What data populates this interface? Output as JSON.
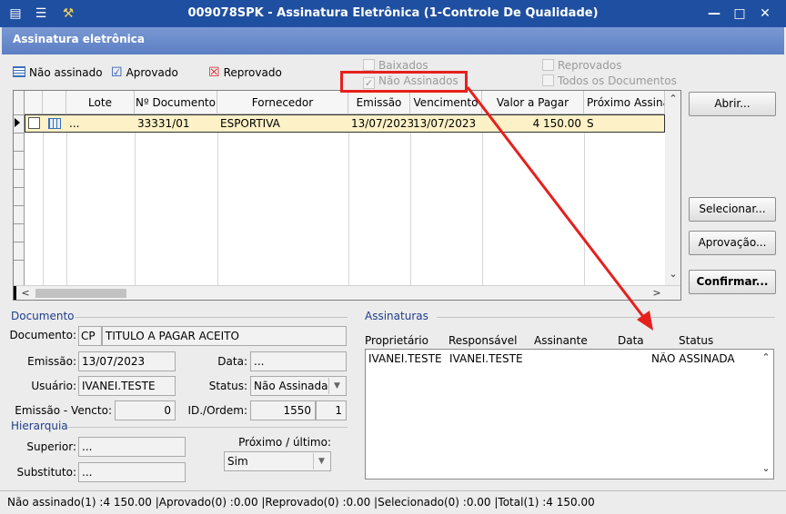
{
  "window": {
    "title": "009078SPK - Assinatura Eletrônica (1-Controle De Qualidade)"
  },
  "header": {
    "title": "Assinatura eletrônica"
  },
  "filters": {
    "nao_assinado": "Não assinado",
    "aprovado": "Aprovado",
    "reprovado": "Reprovado",
    "baixados": "Baixados",
    "nao_assinados": "Não Assinados",
    "reprovados": "Reprovados",
    "todos": "Todos os Documentos"
  },
  "grid": {
    "columns": [
      "Lote",
      "Nº Documento",
      "Fornecedor",
      "Emissão",
      "Vencimento",
      "Valor a Pagar",
      "Próximo Assinar"
    ],
    "rows": [
      {
        "lote": "...",
        "documento": "33331/01",
        "fornecedor": "ESPORTIVA",
        "emissao": "13/07/2023",
        "vencimento": "13/07/2023",
        "valor": "4 150.00",
        "proximo": "S"
      }
    ]
  },
  "buttons": {
    "abrir": "Abrir...",
    "selecionar": "Selecionar...",
    "aprovacao": "Aprovação...",
    "confirmar": "Confirmar..."
  },
  "documento": {
    "section": "Documento",
    "documento_label": "Documento:",
    "doc_code": "CP",
    "doc_desc": "TITULO A PAGAR ACEITO",
    "emissao_label": "Emissão:",
    "emissao": "13/07/2023",
    "data_label": "Data:",
    "data": "...",
    "usuario_label": "Usuário:",
    "usuario": "IVANEI.TESTE",
    "status_label": "Status:",
    "status": "Não Assinada",
    "emissao_vencto_label": "Emissão - Vencto:",
    "emissao_vencto": "0",
    "id_ordem_label": "ID./Ordem:",
    "id": "1550",
    "ordem": "1"
  },
  "hierarquia": {
    "section": "Hierarquia",
    "superior_label": "Superior:",
    "superior": "...",
    "substituto_label": "Substituto:",
    "substituto": "...",
    "proximo_label": "Próximo / último:",
    "proximo": "Sim"
  },
  "assinaturas": {
    "section": "Assinaturas",
    "columns": [
      "Proprietário",
      "Responsável",
      "Assinante",
      "Data",
      "Status"
    ],
    "rows": [
      {
        "proprietario": "IVANEI.TESTE",
        "responsavel": "IVANEI.TESTE",
        "assinante": "",
        "data": "",
        "status": "NÃO ASSINADA"
      }
    ]
  },
  "statusbar": "Não assinado(1) :4 150.00 |Aprovado(0) :0.00 |Reprovado(0) :0.00 |Selecionado(0) :0.00 |Total(1) :4 150.00",
  "colors": {
    "title_bg": "#1f4fa0",
    "header_bg": "#5c7fc4",
    "selected_row": "#fdf1c7",
    "annotation": "#e6201c"
  }
}
